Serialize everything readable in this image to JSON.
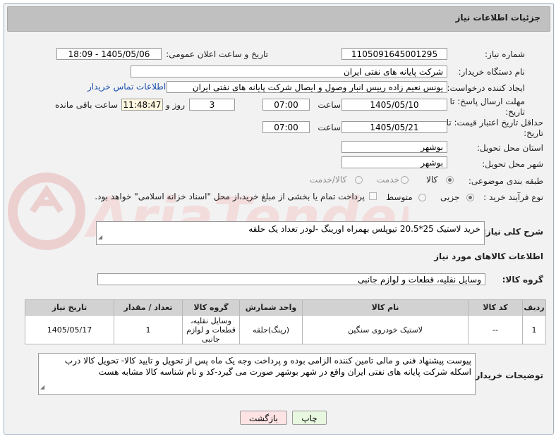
{
  "header": {
    "title": "جزئیات اطلاعات نیاز"
  },
  "watermark": "AriaTender.net",
  "form": {
    "need_number_label": "شماره نیاز:",
    "need_number": "1105091645001295",
    "announce_label": "تاریخ و ساعت اعلان عمومی:",
    "announce_value": "1405/05/06 - 18:09",
    "buyer_org_label": "نام دستگاه خریدار:",
    "buyer_org": "شرکت پایانه های نفتی ایران",
    "creator_label": "ایجاد کننده درخواست:",
    "creator": "یونس نعیم زاده رییس انبار وصول و ایصال شرکت پایانه های نفتی ایران",
    "contact_link": "اطلاعات تماس خریدار",
    "deadline_label": "مهلت ارسال پاسخ: تا تاریخ:",
    "deadline_date": "1405/05/10",
    "time_label": "ساعت",
    "deadline_time": "07:00",
    "days_value": "3",
    "days_label": "روز و",
    "remaining_value": "11:48:47",
    "remaining_label": "ساعت باقی مانده",
    "validity_label": "حداقل تاریخ اعتبار قیمت: تا تاریخ:",
    "validity_date": "1405/05/21",
    "validity_time": "07:00",
    "province_label": "استان محل تحویل:",
    "province": "بوشهر",
    "city_label": "شهر محل تحویل:",
    "city": "بوشهر",
    "category_label": "طبقه بندی موضوعی:",
    "category_options": [
      "کالا",
      "خدمت",
      "کالا/خدمت"
    ],
    "category_selected": "کالا",
    "process_label": "نوع فرآیند خرید :",
    "process_options": [
      "جزیی",
      "متوسط"
    ],
    "process_selected": "جزیی",
    "payment_note": "پرداخت تمام یا بخشی از مبلغ خرید،از محل \"اسناد خزانه اسلامی\" خواهد بود."
  },
  "summary": {
    "label": "شرح کلی نیاز:",
    "text": "خرید لاستیک 25*20.5 تیوپلس بهمراه اورینگ -لودر تعداد یک حلقه"
  },
  "goods": {
    "section_title": "اطلاعات کالاهای مورد نیاز",
    "group_label": "گروه کالا:",
    "group_value": "وسایل نقلیه، قطعات و لوازم جانبی"
  },
  "table": {
    "headers": [
      "ردیف",
      "کد کالا",
      "نام کالا",
      "واحد شمارش",
      "گروه کالا",
      "تعداد / مقدار",
      "تاریخ نیاز"
    ],
    "rows": [
      [
        "1",
        "--",
        "لاستیک خودروی سنگین",
        "(رینگ)حلقه",
        "وسایل نقلیه، قطعات و لوازم جانبی",
        "1",
        "1405/05/17"
      ]
    ]
  },
  "buyer_notes": {
    "label": "توضیحات خریدار:",
    "text": "پیوست پیشنهاد فنی و مالی تامین کننده الزامی بوده و پرداخت وجه یک ماه پس از تحویل و تایید کالا- تحویل کالا درب اسکله شرکت پایانه های نفتی ایران واقع در شهر بوشهر صورت می گیرد-کد و نام شناسه کالا مشابه هست"
  },
  "buttons": {
    "print": "چاپ",
    "back": "بازگشت"
  },
  "colors": {
    "print_bg": "#e8f7df",
    "back_bg": "#fde3e3",
    "watermark": "#f1d6d6",
    "link": "#1a4fb0"
  }
}
